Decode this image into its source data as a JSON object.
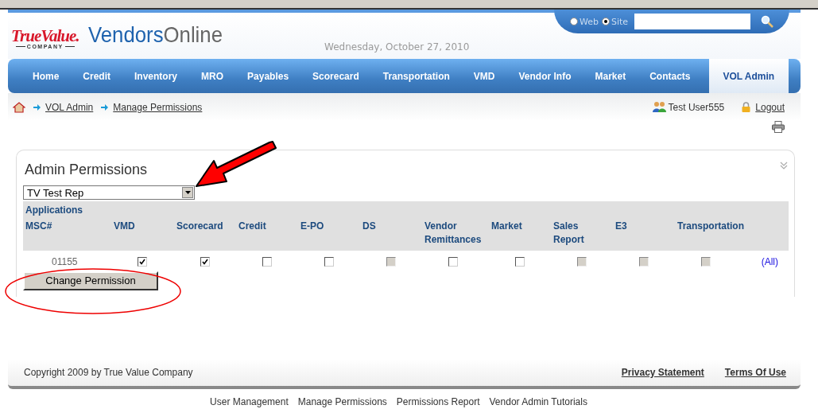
{
  "logo": {
    "brand": "TrueValue.",
    "sub": "COMPANY"
  },
  "site_title": [
    "Vendors",
    "Online"
  ],
  "date": "Wednesday, October 27, 2010",
  "search": {
    "options": [
      {
        "label": "Web",
        "selected": false
      },
      {
        "label": "Site",
        "selected": true
      }
    ]
  },
  "nav": [
    {
      "label": "Home",
      "selected": false
    },
    {
      "label": "Credit",
      "selected": false
    },
    {
      "label": "Inventory",
      "selected": false
    },
    {
      "label": "MRO",
      "selected": false
    },
    {
      "label": "Payables",
      "selected": false
    },
    {
      "label": "Scorecard",
      "selected": false
    },
    {
      "label": "Transportation",
      "selected": false
    },
    {
      "label": "VMD",
      "selected": false
    },
    {
      "label": "Vendor Info",
      "selected": false
    },
    {
      "label": "Market",
      "selected": false
    },
    {
      "label": "Contacts",
      "selected": false
    },
    {
      "label": "VOL Admin",
      "selected": true
    }
  ],
  "breadcrumb": [
    "VOL Admin",
    "Manage Permissions"
  ],
  "user": {
    "name": "Test User555",
    "logout": "Logout"
  },
  "panel": {
    "title": "Admin Permissions",
    "rep_select": {
      "value": "TV Test Rep"
    },
    "group_label": "Applications",
    "columns": [
      "MSC#",
      "VMD",
      "Scorecard",
      "Credit",
      "E-PO",
      "DS",
      "Vendor Remittances",
      "Market",
      "Sales Report",
      "E3",
      "Transportation"
    ],
    "rows": [
      {
        "msc": "01155",
        "link": "(All)",
        "permissions": [
          {
            "checked": true,
            "disabled": false
          },
          {
            "checked": true,
            "disabled": false
          },
          {
            "checked": false,
            "disabled": false
          },
          {
            "checked": false,
            "disabled": false
          },
          {
            "checked": false,
            "disabled": true
          },
          {
            "checked": false,
            "disabled": false
          },
          {
            "checked": false,
            "disabled": false
          },
          {
            "checked": false,
            "disabled": true
          },
          {
            "checked": false,
            "disabled": true
          },
          {
            "checked": false,
            "disabled": true
          }
        ]
      }
    ],
    "button": "Change Permission"
  },
  "footer": {
    "copyright": "Copyright 2009 by True Value Company",
    "links": [
      "Privacy Statement",
      "Terms Of Use"
    ]
  },
  "bottom_links": [
    "User Management",
    "Manage Permissions",
    "Permissions Report",
    "Vendor Admin Tutorials"
  ]
}
